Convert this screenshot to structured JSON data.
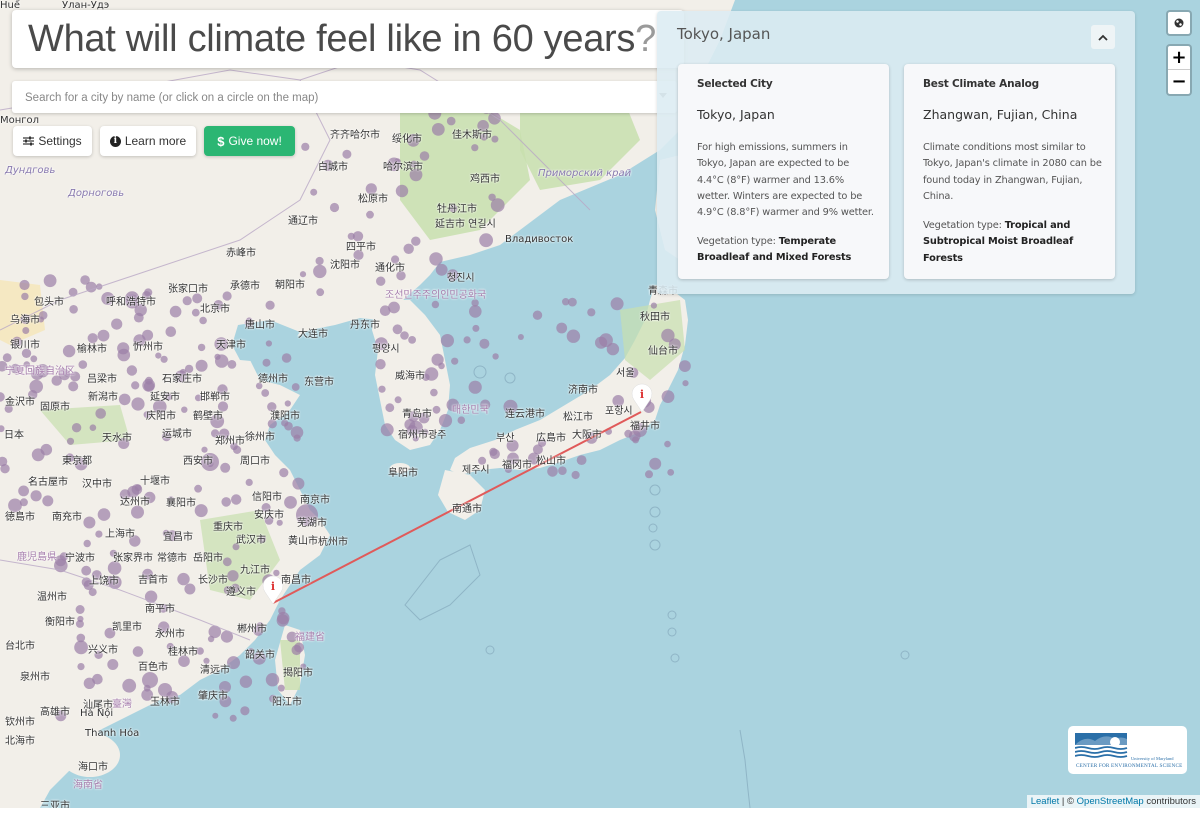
{
  "header": {
    "title": "What will climate feel like in 60 years",
    "title_suffix": "?"
  },
  "search": {
    "placeholder": "Search for a city by name (or click on a circle on the map)",
    "value": ""
  },
  "toolbar": {
    "settings_label": "Settings",
    "learn_more_label": "Learn more",
    "give_label": "Give now!",
    "give_color": "#2bb673"
  },
  "panel": {
    "title": "Tokyo, Japan",
    "collapse_icon": "chevron-up-icon",
    "selected": {
      "heading": "Selected City",
      "city": "Tokyo, Japan",
      "description": "For high emissions, summers in Tokyo, Japan are expected to be 4.4°C (8°F) warmer and 13.6% wetter. Winters are expected to be 4.9°C (8.8°F) warmer and 9% wetter.",
      "vegetation_label": "Vegetation type: ",
      "vegetation_value": "Temperate Broadleaf and Mixed Forests"
    },
    "analog": {
      "heading": "Best Climate Analog",
      "city": "Zhangwan, Fujian, China",
      "description": "Climate conditions most similar to Tokyo, Japan's climate in 2080 can be found today in Zhangwan, Fujian, China.",
      "vegetation_label": "Vegetation type: ",
      "vegetation_value": "Tropical and Subtropical Moist Broadleaf Forests"
    }
  },
  "map_controls": {
    "layers_icon": "globe-icon",
    "zoom_in": "+",
    "zoom_out": "−"
  },
  "map": {
    "ocean_color": "#aad3df",
    "land_color": "#f2efe9",
    "forest_color": "#c8dfae",
    "route_color": "#e05a5a",
    "markers": [
      {
        "name": "tokyo-marker",
        "label": "Tokyo, Japan"
      },
      {
        "name": "zhangwan-marker",
        "label": "Zhangwan, Fujian, China"
      }
    ],
    "labels": [
      {
        "t": "Улан-Удэ",
        "c": "ru-city"
      },
      {
        "t": "Монгол",
        "c": "city"
      },
      {
        "t": "Дундговь",
        "c": "ru"
      },
      {
        "t": "Дорноговь",
        "c": "ru"
      },
      {
        "t": "齐齐哈尔市",
        "c": "city"
      },
      {
        "t": "绥化市",
        "c": "city"
      },
      {
        "t": "佳木斯市",
        "c": "city"
      },
      {
        "t": "白城市",
        "c": "city"
      },
      {
        "t": "哈尔滨市",
        "c": "city"
      },
      {
        "t": "鸡西市",
        "c": "city"
      },
      {
        "t": "Приморский край",
        "c": "ru"
      },
      {
        "t": "松原市",
        "c": "city"
      },
      {
        "t": "通辽市",
        "c": "city"
      },
      {
        "t": "牡丹江市",
        "c": "city"
      },
      {
        "t": "延吉市 연길시",
        "c": "city"
      },
      {
        "t": "Владивосток",
        "c": "city"
      },
      {
        "t": "赤峰市",
        "c": "city"
      },
      {
        "t": "四平市",
        "c": "city"
      },
      {
        "t": "承德市",
        "c": "city"
      },
      {
        "t": "沈阳市",
        "c": "city"
      },
      {
        "t": "通化市",
        "c": "city"
      },
      {
        "t": "청진시",
        "c": "city"
      },
      {
        "t": "包头市",
        "c": "city"
      },
      {
        "t": "呼和浩特市",
        "c": "city"
      },
      {
        "t": "张家口市",
        "c": "city"
      },
      {
        "t": "朝阳市",
        "c": "city"
      },
      {
        "t": "조선민주주의인민공화국",
        "c": "region"
      },
      {
        "t": "青森市",
        "c": "city"
      },
      {
        "t": "乌海市",
        "c": "city"
      },
      {
        "t": "北京市",
        "c": "city"
      },
      {
        "t": "唐山市",
        "c": "city"
      },
      {
        "t": "丹东市",
        "c": "city"
      },
      {
        "t": "秋田市",
        "c": "city"
      },
      {
        "t": "银川市",
        "c": "city"
      },
      {
        "t": "榆林市",
        "c": "city"
      },
      {
        "t": "忻州市",
        "c": "city"
      },
      {
        "t": "天津市",
        "c": "city"
      },
      {
        "t": "大连市",
        "c": "city"
      },
      {
        "t": "평양시",
        "c": "city"
      },
      {
        "t": "仙台市",
        "c": "city"
      },
      {
        "t": "宁夏回族自治区",
        "c": "region"
      },
      {
        "t": "吕梁市",
        "c": "city"
      },
      {
        "t": "石家庄市",
        "c": "city"
      },
      {
        "t": "德州市",
        "c": "city"
      },
      {
        "t": "东营市",
        "c": "city"
      },
      {
        "t": "威海市",
        "c": "city"
      },
      {
        "t": "서울",
        "c": "city"
      },
      {
        "t": "新潟市",
        "c": "city"
      },
      {
        "t": "延安市",
        "c": "city"
      },
      {
        "t": "邯郸市",
        "c": "city"
      },
      {
        "t": "济南市",
        "c": "city"
      },
      {
        "t": "金沢市",
        "c": "city"
      },
      {
        "t": "固原市",
        "c": "city"
      },
      {
        "t": "庆阳市",
        "c": "city"
      },
      {
        "t": "鹤壁市",
        "c": "city"
      },
      {
        "t": "濮阳市",
        "c": "city"
      },
      {
        "t": "青岛市",
        "c": "city"
      },
      {
        "t": "대한민국",
        "c": "region"
      },
      {
        "t": "포항시",
        "c": "city"
      },
      {
        "t": "日本",
        "c": "city"
      },
      {
        "t": "天水市",
        "c": "city"
      },
      {
        "t": "运城市",
        "c": "city"
      },
      {
        "t": "郑州市",
        "c": "city"
      },
      {
        "t": "徐州市",
        "c": "city"
      },
      {
        "t": "连云港市",
        "c": "city"
      },
      {
        "t": "松江市",
        "c": "city"
      },
      {
        "t": "福井市",
        "c": "city"
      },
      {
        "t": "東京都",
        "c": "city"
      },
      {
        "t": "西安市",
        "c": "city"
      },
      {
        "t": "周口市",
        "c": "city"
      },
      {
        "t": "宿州市",
        "c": "city"
      },
      {
        "t": "광주",
        "c": "city"
      },
      {
        "t": "부산",
        "c": "city"
      },
      {
        "t": "広島市",
        "c": "city"
      },
      {
        "t": "大阪市",
        "c": "city"
      },
      {
        "t": "名古屋市",
        "c": "city"
      },
      {
        "t": "汉中市",
        "c": "city"
      },
      {
        "t": "十堰市",
        "c": "city"
      },
      {
        "t": "阜阳市",
        "c": "city"
      },
      {
        "t": "제주시",
        "c": "city"
      },
      {
        "t": "福冈市",
        "c": "city"
      },
      {
        "t": "松山市",
        "c": "city"
      },
      {
        "t": "徳島市",
        "c": "city"
      },
      {
        "t": "南充市",
        "c": "city"
      },
      {
        "t": "达州市",
        "c": "city"
      },
      {
        "t": "襄阳市",
        "c": "city"
      },
      {
        "t": "信阳市",
        "c": "city"
      },
      {
        "t": "南京市",
        "c": "city"
      },
      {
        "t": "南通市",
        "c": "city"
      },
      {
        "t": "鹿児島県",
        "c": "region"
      },
      {
        "t": "重庆市",
        "c": "city"
      },
      {
        "t": "安庆市",
        "c": "city"
      },
      {
        "t": "芜湖市",
        "c": "city"
      },
      {
        "t": "上海市",
        "c": "city"
      },
      {
        "t": "宜昌市",
        "c": "city"
      },
      {
        "t": "武汉市",
        "c": "city"
      },
      {
        "t": "黄山市",
        "c": "city"
      },
      {
        "t": "杭州市",
        "c": "city"
      },
      {
        "t": "宁波市",
        "c": "city"
      },
      {
        "t": "张家界市",
        "c": "city"
      },
      {
        "t": "常德市",
        "c": "city"
      },
      {
        "t": "岳阳市",
        "c": "city"
      },
      {
        "t": "九江市",
        "c": "city"
      },
      {
        "t": "上饶市",
        "c": "city"
      },
      {
        "t": "吉首市",
        "c": "city"
      },
      {
        "t": "长沙市",
        "c": "city"
      },
      {
        "t": "南昌市",
        "c": "city"
      },
      {
        "t": "温州市",
        "c": "city"
      },
      {
        "t": "遵义市",
        "c": "city"
      },
      {
        "t": "南平市",
        "c": "city"
      },
      {
        "t": "衡阳市",
        "c": "city"
      },
      {
        "t": "凯里市",
        "c": "city"
      },
      {
        "t": "永州市",
        "c": "city"
      },
      {
        "t": "郴州市",
        "c": "city"
      },
      {
        "t": "福建省",
        "c": "region"
      },
      {
        "t": "台北市",
        "c": "city"
      },
      {
        "t": "兴义市",
        "c": "city"
      },
      {
        "t": "桂林市",
        "c": "city"
      },
      {
        "t": "韶关市",
        "c": "city"
      },
      {
        "t": "泉州市",
        "c": "city"
      },
      {
        "t": "百色市",
        "c": "city"
      },
      {
        "t": "清远市",
        "c": "city"
      },
      {
        "t": "揭阳市",
        "c": "city"
      },
      {
        "t": "臺灣",
        "c": "region"
      },
      {
        "t": "肇庆市",
        "c": "city"
      },
      {
        "t": "汕尾市",
        "c": "city"
      },
      {
        "t": "玉林市",
        "c": "city"
      },
      {
        "t": "阳江市",
        "c": "city"
      },
      {
        "t": "高雄市",
        "c": "city"
      },
      {
        "t": "钦州市",
        "c": "city"
      },
      {
        "t": "Hà Nội",
        "c": "city"
      },
      {
        "t": "北海市",
        "c": "city"
      },
      {
        "t": "Thanh Hóa",
        "c": "city"
      },
      {
        "t": "海口市",
        "c": "city"
      },
      {
        "t": "海南省",
        "c": "region"
      },
      {
        "t": "三亚市",
        "c": "city"
      },
      {
        "t": "Huế",
        "c": "city"
      }
    ]
  },
  "logo": {
    "line1": "University of Maryland",
    "line2": "CENTER FOR ENVIRONMENTAL SCIENCE"
  },
  "attribution": {
    "leaflet": "Leaflet",
    "separator": " | © ",
    "osm": "OpenStreetMap",
    "suffix": " contributors"
  }
}
